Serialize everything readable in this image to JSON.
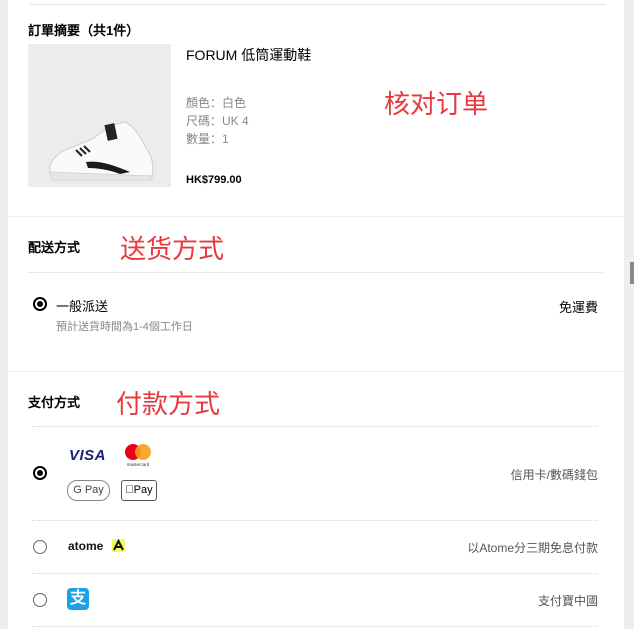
{
  "order_summary": {
    "title": "訂單摘要（共1件）",
    "annotation": "核对订单",
    "product": {
      "name": "FORUM 低筒運動鞋",
      "color": "顏色：白色",
      "size": "尺碼：UK 4",
      "quantity": "數量：1",
      "price": "HK$799.00"
    }
  },
  "shipping": {
    "title": "配送方式",
    "annotation": "送货方式",
    "option": {
      "label": "一般派送",
      "eta": "預計送貨時間為1-4個工作日",
      "fee": "免運費",
      "selected": true
    }
  },
  "payment": {
    "title": "支付方式",
    "annotation": "付款方式",
    "options": [
      {
        "visa_label": "VISA",
        "mastercard_label": "mastercard",
        "gpay_label": "G Pay",
        "applepay_label": "Pay",
        "label": "信用卡/數碼錢包",
        "selected": true
      },
      {
        "brand": "atome",
        "label": "以Atome分三期免息付款",
        "selected": false
      },
      {
        "brand_glyph": "支",
        "label": "支付寶中國",
        "selected": false
      }
    ]
  },
  "colors": {
    "annotation": "#e8383d",
    "visa": "#1a1f71",
    "alipay": "#1aa1e6",
    "atome_accent": "#f0ff5f"
  },
  "icons": [
    "shoe-product-image",
    "visa-logo",
    "mastercard-logo",
    "google-pay-logo",
    "apple-pay-logo",
    "atome-logo",
    "alipay-logo"
  ]
}
